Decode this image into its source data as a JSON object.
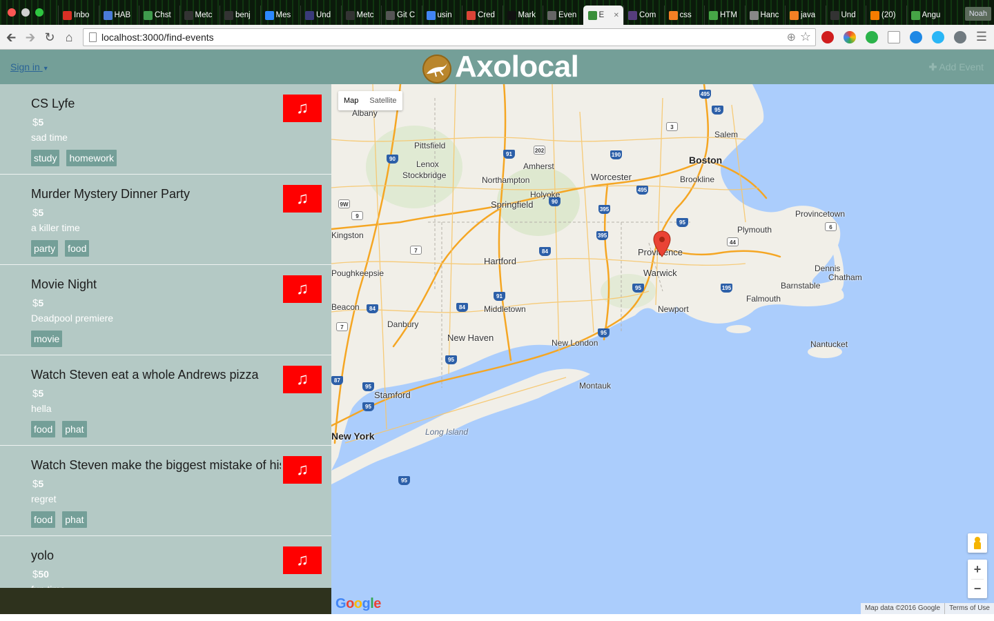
{
  "browser": {
    "tabs": [
      {
        "label": "Inbo",
        "color": "#d93025"
      },
      {
        "label": "HAB",
        "color": "#4a7bd8"
      },
      {
        "label": "Chst",
        "color": "#3f9b4d"
      },
      {
        "label": "Metc",
        "color": "#333333"
      },
      {
        "label": "benj",
        "color": "#333333"
      },
      {
        "label": "Mes",
        "color": "#2d88ff"
      },
      {
        "label": "Und",
        "color": "#3a3a7a"
      },
      {
        "label": "Metc",
        "color": "#333333"
      },
      {
        "label": "Git C",
        "color": "#555555"
      },
      {
        "label": "usin",
        "color": "#4285f4"
      },
      {
        "label": "Cred",
        "color": "#db4437"
      },
      {
        "label": "Mark",
        "color": "#111111"
      },
      {
        "label": "Even",
        "color": "#666666"
      },
      {
        "label": "E",
        "color": "#3a8f3a",
        "active": true
      },
      {
        "label": "Com",
        "color": "#563d7c"
      },
      {
        "label": "css",
        "color": "#f48024"
      },
      {
        "label": "HTM",
        "color": "#46a546"
      },
      {
        "label": "Hanc",
        "color": "#888888"
      },
      {
        "label": "java",
        "color": "#f48024"
      },
      {
        "label": "Und",
        "color": "#333333"
      },
      {
        "label": "(20)",
        "color": "#f57d00"
      },
      {
        "label": "Angu",
        "color": "#46a546"
      }
    ],
    "profile": "Noah",
    "url": "localhost:3000/find-events"
  },
  "header": {
    "signin": "Sign in",
    "brand": "Axolocal",
    "add_event": "Add Event"
  },
  "events": [
    {
      "title": "CS Lyfe",
      "price": "5",
      "desc": "sad time",
      "tags": [
        "study",
        "homework"
      ]
    },
    {
      "title": "Murder Mystery Dinner Party",
      "price": "5",
      "desc": "a killer time",
      "tags": [
        "party",
        "food"
      ]
    },
    {
      "title": "Movie Night",
      "price": "5",
      "desc": "Deadpool premiere",
      "tags": [
        "movie"
      ]
    },
    {
      "title": "Watch Steven eat a whole Andrews pizza",
      "price": "5",
      "desc": "hella",
      "tags": [
        "food",
        "phat"
      ]
    },
    {
      "title": "Watch Steven make the biggest mistake of his life",
      "price": "5",
      "desc": "regret",
      "tags": [
        "food",
        "phat"
      ]
    },
    {
      "title": "yolo",
      "price": "50",
      "desc": "fun time",
      "tags": []
    }
  ],
  "map": {
    "map_type": [
      "Map",
      "Satellite"
    ],
    "attribution": "Map data ©2016 Google",
    "terms": "Terms of Use",
    "google": "Google",
    "places": [
      {
        "name": "Boston",
        "cls": "major"
      },
      {
        "name": "Salem",
        "cls": ""
      },
      {
        "name": "Brookline",
        "cls": ""
      },
      {
        "name": "Worcester",
        "cls": "big"
      },
      {
        "name": "Providence",
        "cls": "big"
      },
      {
        "name": "Warwick",
        "cls": "big"
      },
      {
        "name": "Newport",
        "cls": ""
      },
      {
        "name": "Plymouth",
        "cls": ""
      },
      {
        "name": "Provincetown",
        "cls": ""
      },
      {
        "name": "Barnstable",
        "cls": ""
      },
      {
        "name": "Dennis",
        "cls": ""
      },
      {
        "name": "Chatham",
        "cls": ""
      },
      {
        "name": "Falmouth",
        "cls": ""
      },
      {
        "name": "Nantucket",
        "cls": ""
      },
      {
        "name": "Pittsfield",
        "cls": ""
      },
      {
        "name": "Lenox",
        "cls": ""
      },
      {
        "name": "Stockbridge",
        "cls": ""
      },
      {
        "name": "Amherst",
        "cls": ""
      },
      {
        "name": "Northampton",
        "cls": ""
      },
      {
        "name": "Holyoke",
        "cls": ""
      },
      {
        "name": "Springfield",
        "cls": "big"
      },
      {
        "name": "Hartford",
        "cls": "big"
      },
      {
        "name": "Middletown",
        "cls": ""
      },
      {
        "name": "New Haven",
        "cls": "big"
      },
      {
        "name": "New London",
        "cls": ""
      },
      {
        "name": "Danbury",
        "cls": ""
      },
      {
        "name": "Stamford",
        "cls": "big"
      },
      {
        "name": "Montauk",
        "cls": ""
      },
      {
        "name": "Long Island",
        "cls": "water"
      },
      {
        "name": "Albany",
        "cls": ""
      },
      {
        "name": "Kingston",
        "cls": ""
      },
      {
        "name": "Poughkeepsie",
        "cls": ""
      },
      {
        "name": "Beacon",
        "cls": ""
      },
      {
        "name": "New York",
        "cls": "major"
      }
    ],
    "shields": [
      "495",
      "95",
      "3",
      "90",
      "91",
      "202",
      "190",
      "495",
      "395",
      "90",
      "395",
      "95",
      "44",
      "6",
      "84",
      "7",
      "9W",
      "9",
      "84",
      "91",
      "84",
      "95",
      "95",
      "195",
      "95",
      "95",
      "95",
      "87",
      "95",
      "7"
    ]
  }
}
